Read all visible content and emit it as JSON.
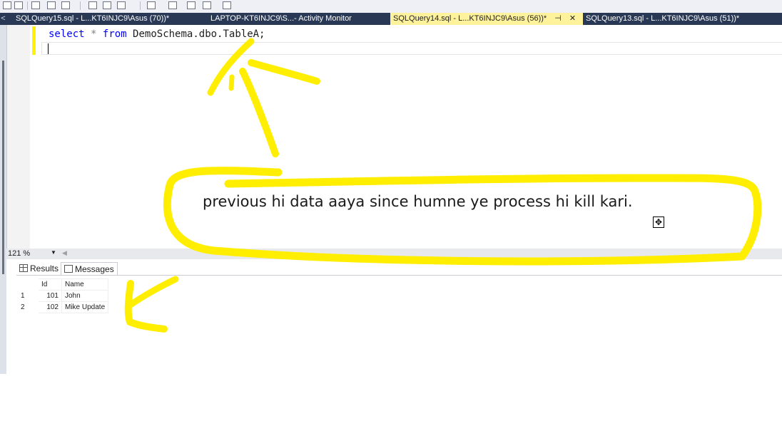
{
  "tabs": [
    {
      "label": "SQLQuery15.sql - L...KT6INJC9\\Asus (70))*",
      "active": false
    },
    {
      "label": "LAPTOP-KT6INJC9\\S...- Activity Monitor",
      "active": false
    },
    {
      "label": "SQLQuery14.sql - L...KT6INJC9\\Asus (56))*",
      "active": true,
      "pin_icon": "pin-icon",
      "close_icon": "close-icon"
    },
    {
      "label": "SQLQuery13.sql - L...KT6INJC9\\Asus (51))*",
      "active": false
    }
  ],
  "tabstrip": {
    "scroll_left": "<"
  },
  "editor": {
    "code": {
      "kw1": "select",
      "op": "*",
      "kw2": "from",
      "rest": "DemoSchema.dbo.TableA;"
    }
  },
  "zoom": {
    "level": "121 %",
    "dropdown_icon": "chevron-down-icon",
    "scroll_icon": "scroll-left-icon"
  },
  "results": {
    "tabs": [
      {
        "label": "Results",
        "icon": "grid-icon"
      },
      {
        "label": "Messages",
        "icon": "messages-icon"
      }
    ],
    "columns": [
      "Id",
      "Name"
    ],
    "rows": [
      {
        "num": "1",
        "id": "101",
        "name": "John"
      },
      {
        "num": "2",
        "id": "102",
        "name": "Mike Update"
      }
    ]
  },
  "annotation": {
    "text": "previous hi data aaya since humne ye process hi kill kari.",
    "color": "#ffee00"
  },
  "colors": {
    "tabstrip": "#293955",
    "active_tab": "#fff29d",
    "keyword": "#0000ff"
  }
}
